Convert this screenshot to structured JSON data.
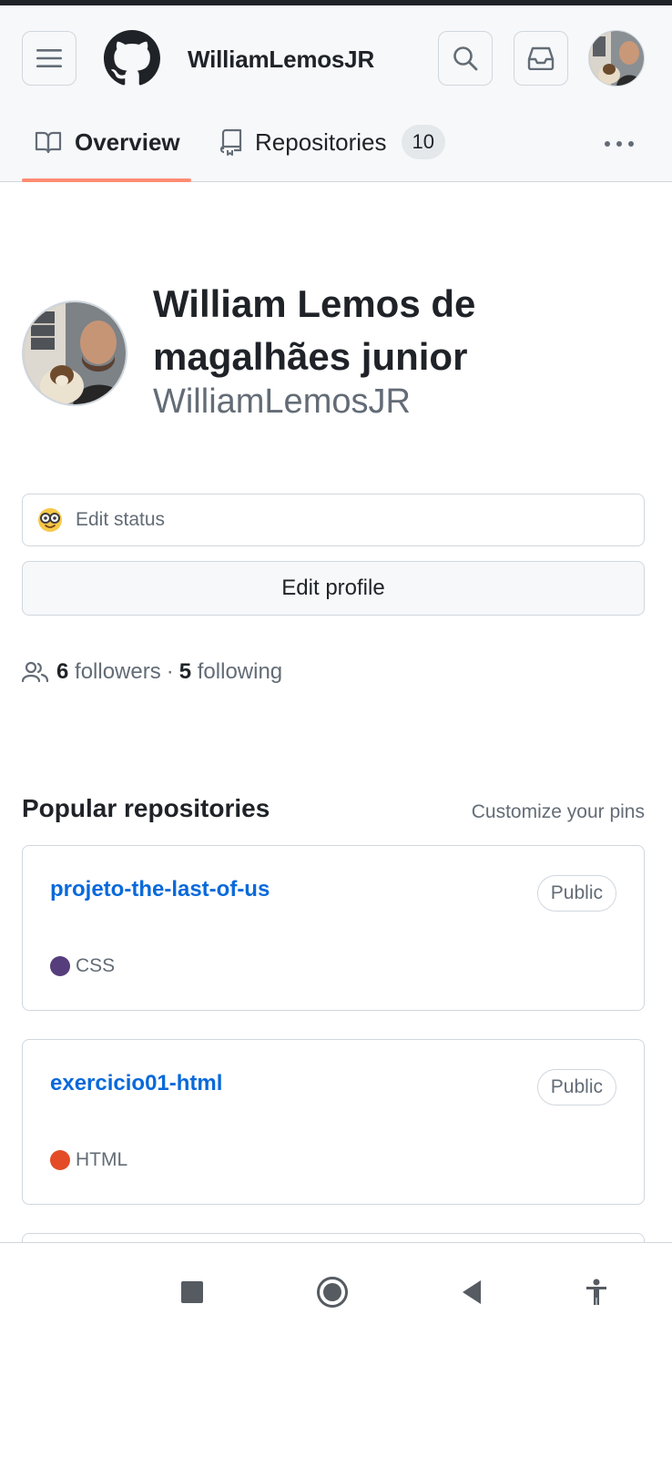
{
  "header": {
    "username": "WilliamLemosJR",
    "menu_icon": "hamburger-icon",
    "logo_icon": "github-logo",
    "search_icon": "search-icon",
    "inbox_icon": "inbox-icon"
  },
  "tabs": [
    {
      "label": "Overview",
      "icon": "book-icon",
      "active": true
    },
    {
      "label": "Repositories",
      "icon": "repo-icon",
      "count": "10",
      "active": false
    }
  ],
  "profile": {
    "full_name": "William Lemos de magalhães junior",
    "login": "WilliamLemosJR",
    "status_label": "Edit status",
    "edit_profile_label": "Edit profile",
    "followers_count": "6",
    "followers_label": "followers",
    "separator": "·",
    "following_count": "5",
    "following_label": "following"
  },
  "popular": {
    "title": "Popular repositories",
    "customize_label": "Customize your pins",
    "repos": [
      {
        "name": "projeto-the-last-of-us",
        "visibility": "Public",
        "language": "CSS",
        "language_color": "#563d7c"
      },
      {
        "name": "exercicio01-html",
        "visibility": "Public",
        "language": "HTML",
        "language_color": "#e34c26"
      }
    ]
  },
  "colors": {
    "accent_link": "#0969da",
    "tab_underline": "#fd8c73",
    "header_bg": "#f6f8fa"
  },
  "android_nav": [
    "stop-icon",
    "home-icon",
    "back-icon",
    "accessibility-icon"
  ]
}
